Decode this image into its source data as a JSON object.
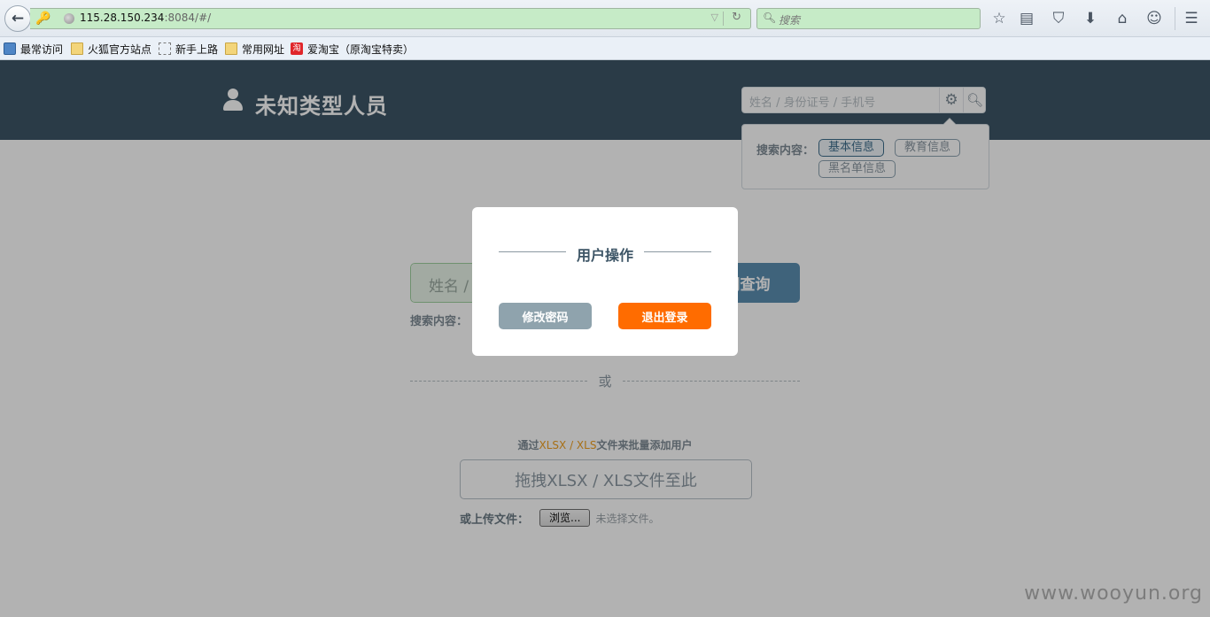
{
  "browser": {
    "url_host": "115.28.150.234",
    "url_rest": ":8084/#/",
    "search_placeholder": "搜索",
    "bookmarks": [
      "最常访问",
      "火狐官方站点",
      "新手上路",
      "常用网址",
      "爱淘宝（原淘宝特卖）"
    ],
    "bookmark_red_icon_char": "淘"
  },
  "header": {
    "title": "未知类型人员",
    "search_placeholder": "姓名 / 身份证号 / 手机号",
    "popover_label": "搜索内容：",
    "tags": [
      "基本信息",
      "教育信息",
      "黑名单信息"
    ]
  },
  "main": {
    "search_placeholder": "姓名 /",
    "search_button": "网查询",
    "scope_label": "搜索内容：",
    "or_text": "或",
    "upload_hint_prefix": "通过",
    "upload_hint_formats": "XLSX / XLS",
    "upload_hint_suffix": "文件来批量添加用户",
    "drop_zone_text": "拖拽XLSX / XLS文件至此",
    "file_label": "或上传文件：",
    "browse_button": "浏览...",
    "no_file_text": "未选择文件。"
  },
  "modal": {
    "title": "用户操作",
    "change_password": "修改密码",
    "logout": "退出登录"
  },
  "watermark": "www.wooyun.org",
  "colors": {
    "header_bg": "#3d5566",
    "logout_button": "#ff6c00",
    "change_password_button": "#8fa3ad",
    "url_bar_bg": "#c6ebc7"
  }
}
